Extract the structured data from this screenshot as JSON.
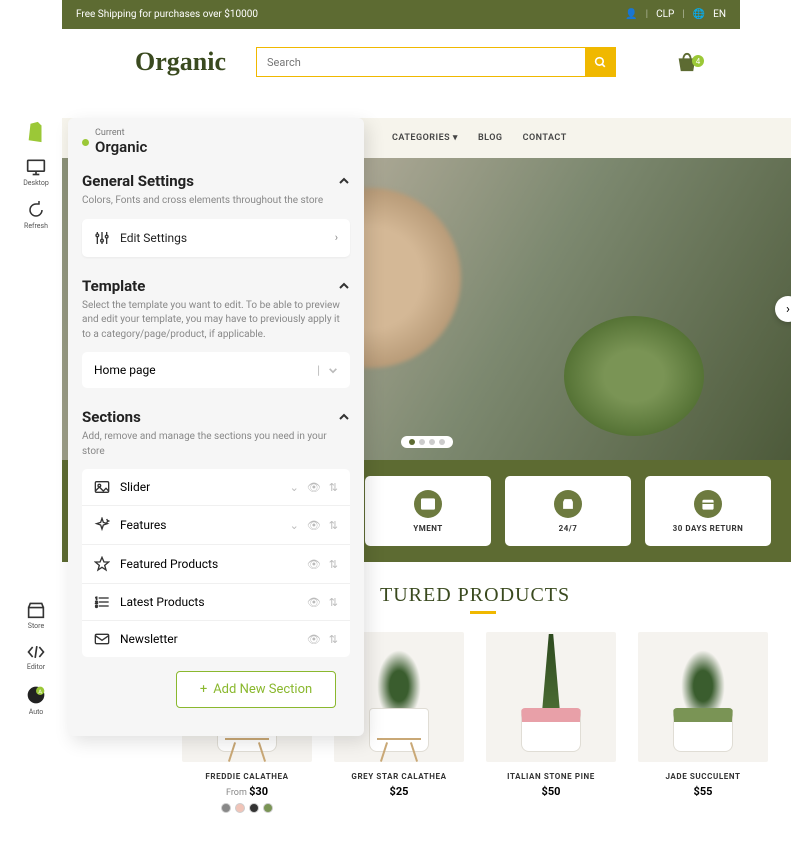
{
  "topbar": {
    "promo": "Free Shipping for purchases over $10000",
    "currency": "CLP",
    "lang": "EN"
  },
  "header": {
    "brand": "Organic",
    "search_placeholder": "Search",
    "cart_count": "4"
  },
  "rail": {
    "top": [
      {
        "label": "Desktop"
      },
      {
        "label": "Refresh"
      }
    ],
    "bottom": [
      {
        "label": "Store"
      },
      {
        "label": "Editor"
      },
      {
        "label": "Auto"
      }
    ]
  },
  "panel": {
    "current_label": "Current",
    "current_name": "Organic",
    "general": {
      "title": "General Settings",
      "desc": "Colors, Fonts and cross elements throughout the store",
      "edit": "Edit Settings"
    },
    "template": {
      "title": "Template",
      "desc": "Select the template you want to edit. To be able to preview and edit your template, you may have to previously apply it to a category/page/product, if applicable.",
      "selected": "Home page"
    },
    "sections": {
      "title": "Sections",
      "desc": "Add, remove and manage the sections you need in your store",
      "items": [
        {
          "label": "Slider"
        },
        {
          "label": "Features"
        },
        {
          "label": "Featured Products"
        },
        {
          "label": "Latest Products"
        },
        {
          "label": "Newsletter"
        }
      ],
      "add": "Add New Section"
    }
  },
  "preview": {
    "nav": [
      "CATEGORIES",
      "BLOG",
      "CONTACT"
    ],
    "features": [
      {
        "label": "YMENT"
      },
      {
        "label": "24/7"
      },
      {
        "label": "30 DAYS RETURN"
      }
    ],
    "featured_title": "TURED PRODUCTS",
    "products": [
      {
        "name": "FREDDIE CALATHEA",
        "price": "$30",
        "from": "From ",
        "swatches": [
          "#888",
          "#f0c4b8",
          "#333",
          "#7a9455"
        ]
      },
      {
        "name": "GREY STAR CALATHEA",
        "price": "$25"
      },
      {
        "name": "ITALIAN STONE PINE",
        "price": "$50"
      },
      {
        "name": "JADE SUCCULENT",
        "price": "$55"
      }
    ]
  }
}
